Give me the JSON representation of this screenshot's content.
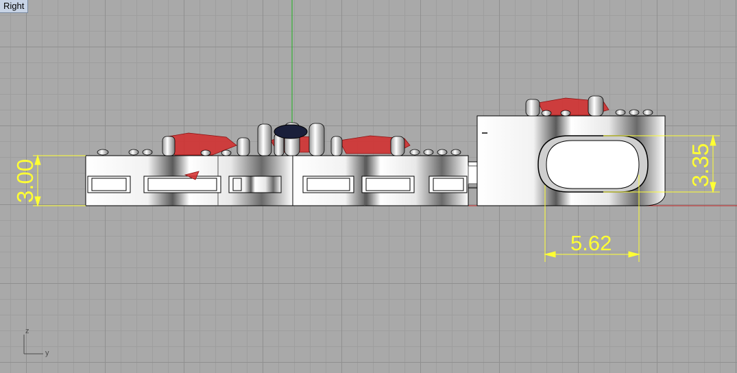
{
  "viewport": {
    "title": "Right"
  },
  "dimensions": {
    "height_left": "3.00",
    "height_right": "3.35",
    "width_bottom": "5.62"
  },
  "axes": {
    "vertical": "z",
    "horizontal": "y"
  },
  "colors": {
    "dimension": "#ffff33",
    "gem": "#d42a2a",
    "z_axis": "#1fb41f",
    "y_axis": "#c01e1e",
    "grid": "#8f8f8f"
  }
}
